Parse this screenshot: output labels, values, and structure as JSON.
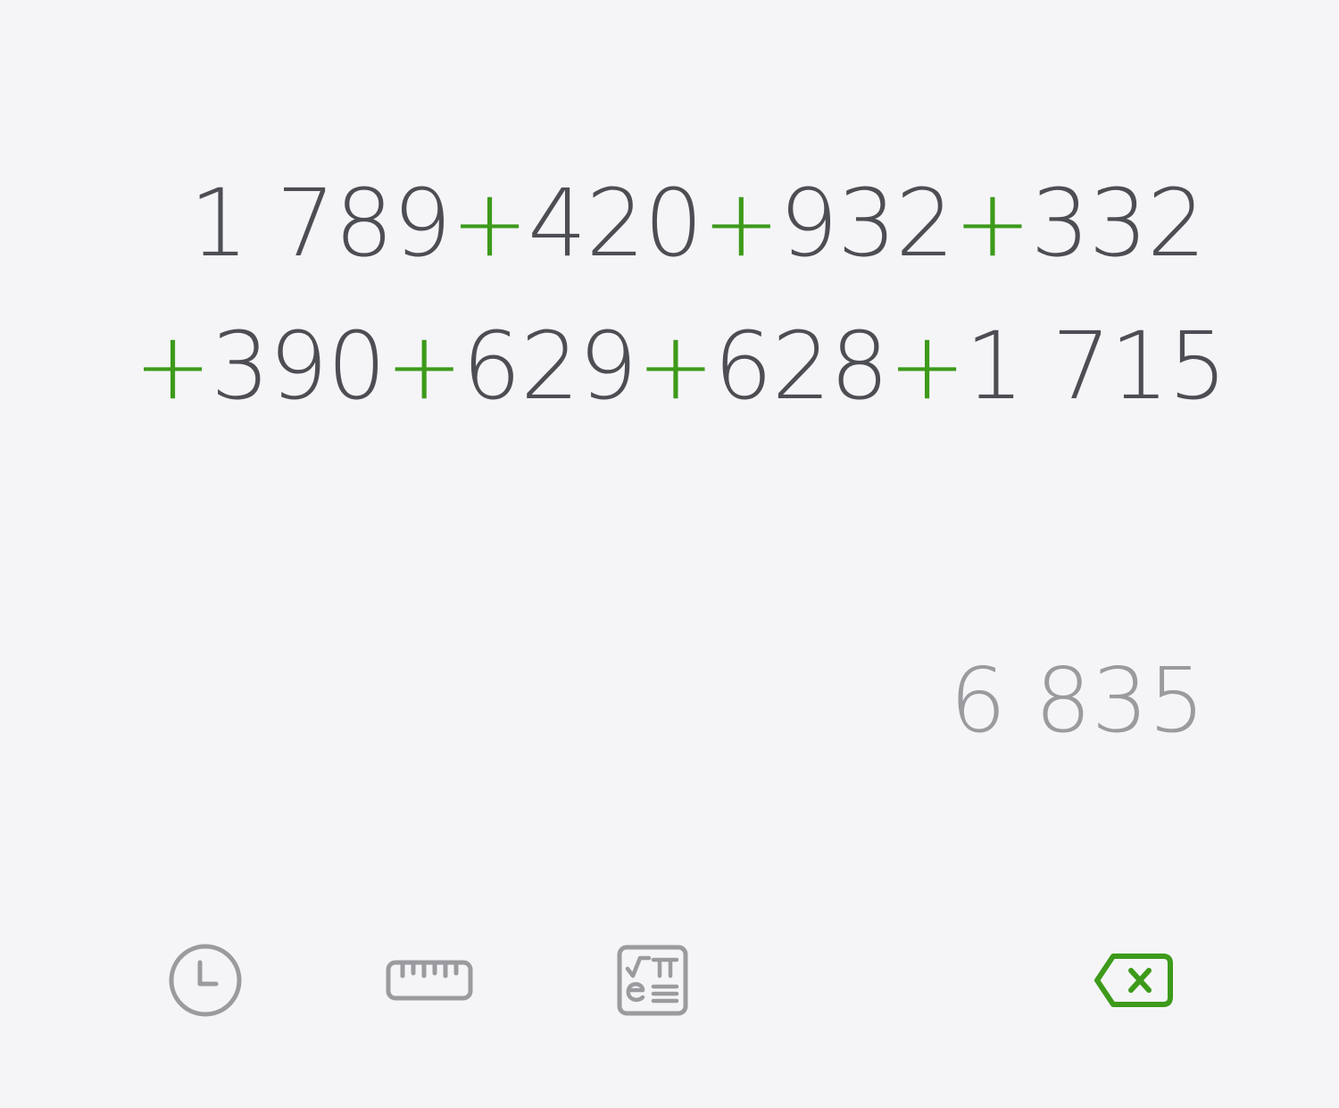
{
  "expression": {
    "line1": [
      {
        "type": "num",
        "text": "1 789"
      },
      {
        "type": "op",
        "text": "+"
      },
      {
        "type": "num",
        "text": "420"
      },
      {
        "type": "op",
        "text": "+"
      },
      {
        "type": "num",
        "text": "932"
      },
      {
        "type": "op",
        "text": "+"
      },
      {
        "type": "num",
        "text": "332"
      }
    ],
    "line2": [
      {
        "type": "op",
        "text": "+"
      },
      {
        "type": "num",
        "text": "390"
      },
      {
        "type": "op",
        "text": "+"
      },
      {
        "type": "num",
        "text": "629"
      },
      {
        "type": "op",
        "text": "+"
      },
      {
        "type": "num",
        "text": "628"
      },
      {
        "type": "op",
        "text": "+"
      },
      {
        "type": "num",
        "text": "1 715"
      }
    ]
  },
  "result": "6 835",
  "toolbar": {
    "icons": [
      "history-icon",
      "unit-converter-icon",
      "scientific-icon",
      "backspace-icon"
    ]
  },
  "colors": {
    "operator": "#3d9a1a",
    "digits": "#4d4e53",
    "result": "#9a9a9f",
    "icon_gray": "#9a9a9f",
    "accent": "#3d9a1a",
    "background": "#f5f5f8"
  }
}
